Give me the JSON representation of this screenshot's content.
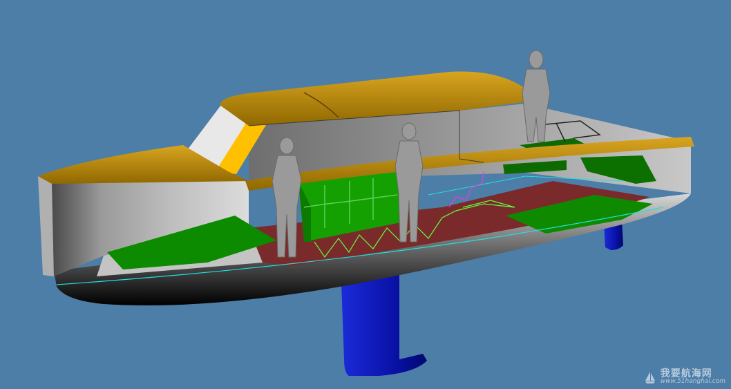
{
  "scene": {
    "title": "",
    "colors": {
      "background": "#4d7ea8",
      "roof": "#b8860b",
      "windshield_accent": "#ffc000",
      "hull_side": "#8a8a8a",
      "hull_bottom": "#000000",
      "deck_red": "#7a2a2a",
      "cushion_green": "#0c8a00",
      "seat_green": "#14a000",
      "foil_blue": "#0010c0",
      "figure_gray": "#9a9a9a",
      "waterline_cyan": "#20e0e0",
      "wire_magenta": "#e040e0"
    },
    "icons": [
      "boat-hull",
      "foil-strut",
      "human-figure"
    ]
  },
  "watermark": {
    "title": "我要航海网",
    "url": "www.51hanghai.com"
  }
}
